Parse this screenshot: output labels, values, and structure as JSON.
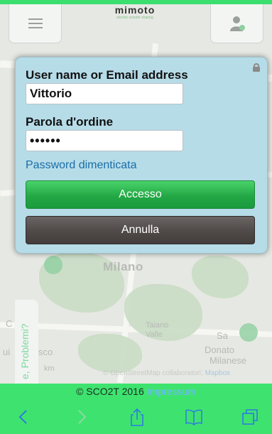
{
  "header": {
    "logo": "mimoto",
    "logo_sub": "electric scooter sharing"
  },
  "map": {
    "labels": {
      "milano": "Milano",
      "taiano": "Taiano",
      "valle": "Valle",
      "san": "Sa",
      "donato": "Donato",
      "milanese": "Milanese",
      "sco": "sco",
      "ui": "ui",
      "c": "C",
      "km": "km"
    },
    "side_tab": "e, Problemi?",
    "attribution": "© OpenStreetMap collaboratori;",
    "attribution_link": "Mapbox"
  },
  "login": {
    "username_label": "User name or Email address",
    "username_value": "Vittorio",
    "password_label": "Parola d'ordine",
    "password_value": "••••••",
    "forgot": "Password dimenticata",
    "submit": "Accesso",
    "cancel": "Annulla"
  },
  "footer": {
    "copyright": "© SCO2T 2016",
    "impressum": "Impressum"
  },
  "colors": {
    "accent": "#3ee36f",
    "dialog": "#b6dce8",
    "primary_button": "#23a846",
    "cancel_button": "#4f4948",
    "link": "#1a6ea8"
  },
  "toolbar": {
    "icons": [
      "back-icon",
      "forward-icon",
      "share-icon",
      "bookmarks-icon",
      "tabs-icon"
    ]
  }
}
